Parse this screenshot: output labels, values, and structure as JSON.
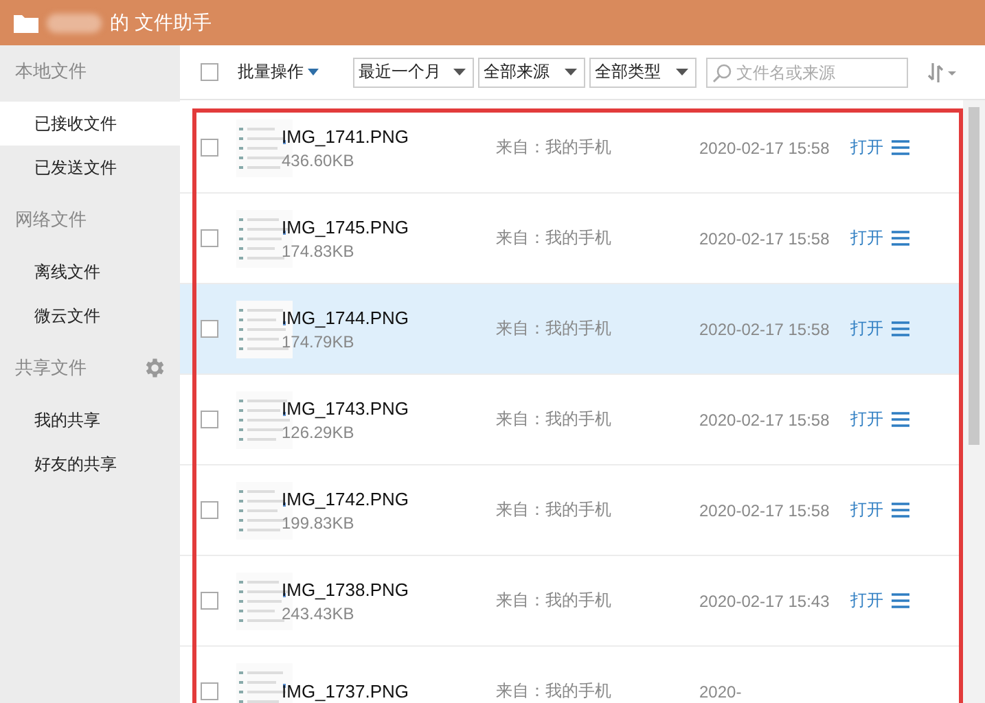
{
  "window": {
    "title": "的 文件助手"
  },
  "sidebar": {
    "sections": [
      {
        "label": "本地文件",
        "items": [
          {
            "label": "已接收文件",
            "selected": true
          },
          {
            "label": "已发送文件",
            "selected": false
          }
        ]
      },
      {
        "label": "网络文件",
        "items": [
          {
            "label": "离线文件",
            "selected": false
          },
          {
            "label": "微云文件",
            "selected": false
          }
        ]
      },
      {
        "label": "共享文件",
        "settings": true,
        "items": [
          {
            "label": "我的共享",
            "selected": false
          },
          {
            "label": "好友的共享",
            "selected": false
          }
        ]
      }
    ]
  },
  "toolbar": {
    "select_all": {
      "checked": false
    },
    "batch": "批量操作",
    "filters": [
      "最近一个月",
      "全部来源",
      "全部类型"
    ],
    "search": {
      "placeholder": "文件名或来源"
    }
  },
  "files": [
    {
      "name": "IMG_1741.PNG",
      "size": "436.60KB",
      "source": "来自：我的手机",
      "time": "2020-02-17 15:58",
      "action": "打开",
      "checked": false,
      "selected": false
    },
    {
      "name": "IMG_1745.PNG",
      "size": "174.83KB",
      "source": "来自：我的手机",
      "time": "2020-02-17 15:58",
      "action": "打开",
      "checked": false,
      "selected": false
    },
    {
      "name": "IMG_1744.PNG",
      "size": "174.79KB",
      "source": "来自：我的手机",
      "time": "2020-02-17 15:58",
      "action": "打开",
      "checked": false,
      "selected": true
    },
    {
      "name": "IMG_1743.PNG",
      "size": "126.29KB",
      "source": "来自：我的手机",
      "time": "2020-02-17 15:58",
      "action": "打开",
      "checked": false,
      "selected": false
    },
    {
      "name": "IMG_1742.PNG",
      "size": "199.83KB",
      "source": "来自：我的手机",
      "time": "2020-02-17 15:58",
      "action": "打开",
      "checked": false,
      "selected": false
    },
    {
      "name": "IMG_1738.PNG",
      "size": "243.43KB",
      "source": "来自：我的手机",
      "time": "2020-02-17 15:43",
      "action": "打开",
      "checked": false,
      "selected": false
    },
    {
      "name": "IMG_1737.PNG",
      "source": "来自：我的手机",
      "time": "2020-",
      "checked": false,
      "selected": false
    }
  ]
}
